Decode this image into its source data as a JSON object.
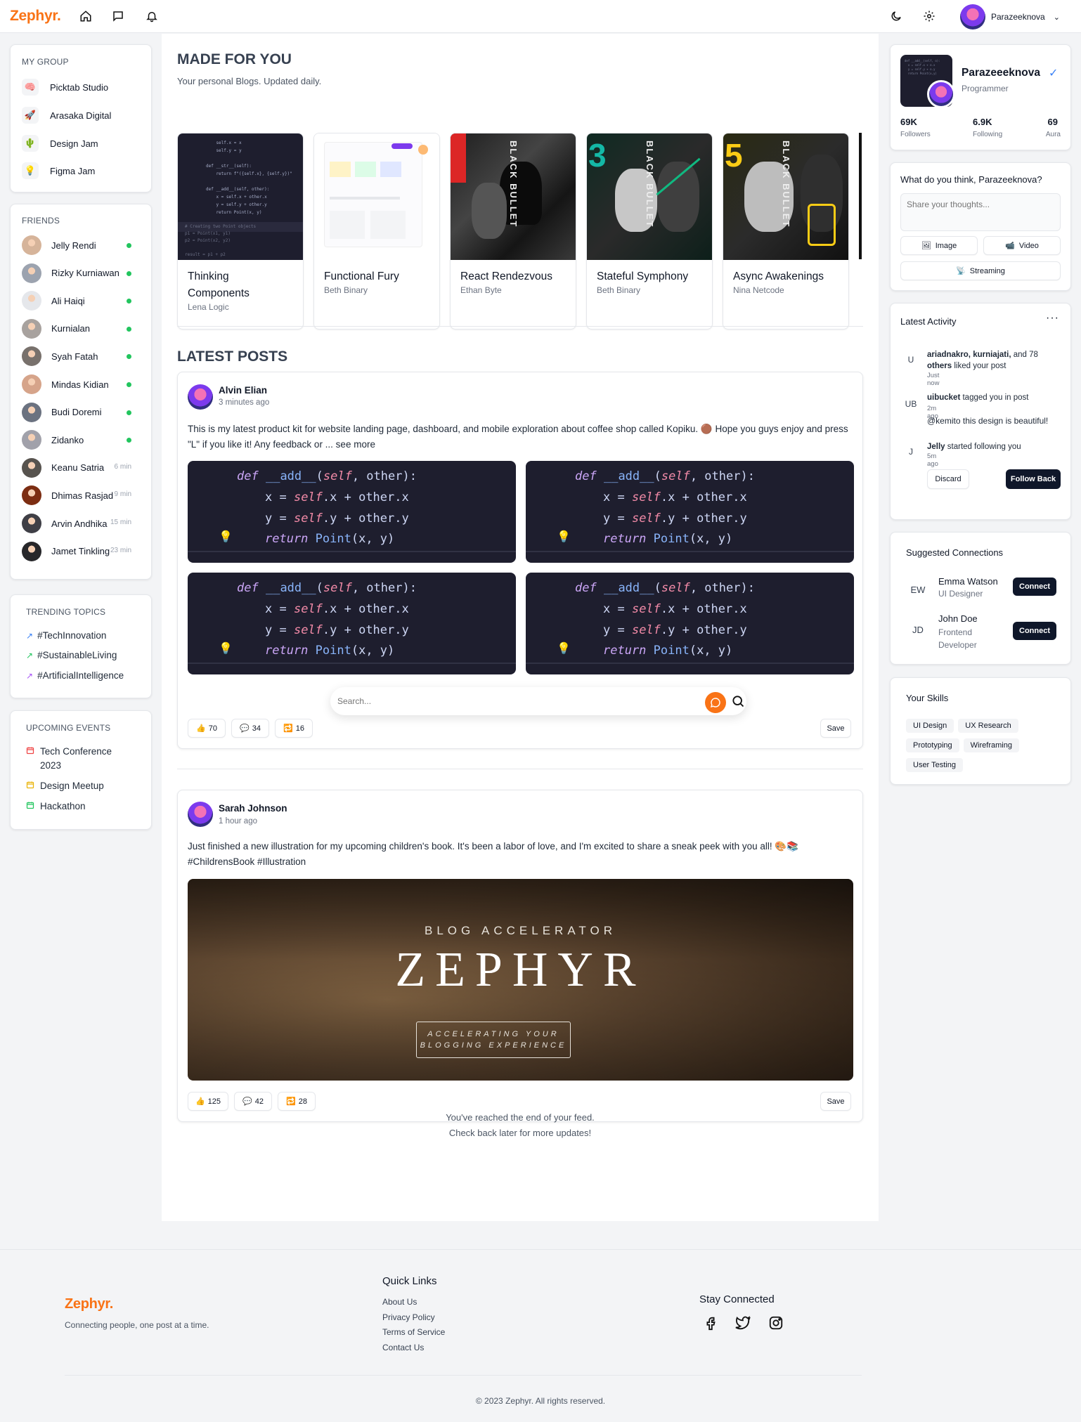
{
  "header": {
    "logo": "Zephyr.",
    "user_name": "Parazeeknova"
  },
  "my_group": {
    "title": "MY GROUP",
    "items": [
      {
        "label": "Picktab Studio",
        "icon": "brain-icon"
      },
      {
        "label": "Arasaka Digital",
        "icon": "rocket-icon"
      },
      {
        "label": "Design Jam",
        "icon": "cactus-icon"
      },
      {
        "label": "Figma Jam",
        "icon": "lightbulb-icon"
      }
    ]
  },
  "friends": {
    "title": "FRIENDS",
    "items": [
      {
        "name": "Jelly Rendi",
        "status": "online"
      },
      {
        "name": "Rizky Kurniawan",
        "status": "online"
      },
      {
        "name": "Ali Haiqi",
        "status": "online"
      },
      {
        "name": "Kurnialan",
        "status": "online"
      },
      {
        "name": "Syah Fatah",
        "status": "online"
      },
      {
        "name": "Mindas Kidian",
        "status": "online"
      },
      {
        "name": "Budi Doremi",
        "status": "online"
      },
      {
        "name": "Zidanko",
        "status": "online"
      },
      {
        "name": "Keanu Satria",
        "status": "6 min"
      },
      {
        "name": "Dhimas Rasjad",
        "status": "9 min"
      },
      {
        "name": "Arvin Andhika",
        "status": "15 min"
      },
      {
        "name": "Jamet Tinkling",
        "status": "23 min"
      }
    ]
  },
  "trending": {
    "title": "TRENDING TOPICS",
    "items": [
      {
        "label": "#TechInnovation",
        "color": "#3b82f6"
      },
      {
        "label": "#SustainableLiving",
        "color": "#22c55e"
      },
      {
        "label": "#ArtificialIntelligence",
        "color": "#a855f7"
      }
    ]
  },
  "events": {
    "title": "UPCOMING EVENTS",
    "items": [
      {
        "label": "Tech Conference 2023",
        "color": "#ef4444"
      },
      {
        "label": "Design Meetup",
        "color": "#eab308"
      },
      {
        "label": "Hackathon",
        "color": "#22c55e"
      }
    ]
  },
  "made_for_you": {
    "title": "MADE FOR YOU",
    "subtitle": "Your personal Blogs. Updated daily.",
    "blogs": [
      {
        "title": "Thinking Components",
        "author": "Lena Logic"
      },
      {
        "title": "Functional Fury",
        "author": "Beth Binary"
      },
      {
        "title": "React Rendezvous",
        "author": "Ethan Byte"
      },
      {
        "title": "Stateful Symphony",
        "author": "Beth Binary"
      },
      {
        "title": "Async Awakenings",
        "author": "Nina Netcode"
      }
    ]
  },
  "latest_posts": {
    "title": "LATEST POSTS",
    "code_lines": [
      "def __add__(self, other):",
      "x = self.x + other.x",
      "y = self.y + other.y",
      "return Point(x, y)"
    ],
    "posts": [
      {
        "author": "Alvin Elian",
        "time": "3 minutes ago",
        "text": "This is my latest product kit for website landing page, dashboard, and mobile exploration about coffee shop called Kopiku. 🟤  Hope you guys enjoy and press \"L\" if you like it! Any feedback or ... see more",
        "likes": "70",
        "comments": "34",
        "shares": "16",
        "save": "Save"
      },
      {
        "author": "Sarah Johnson",
        "time": "1 hour ago",
        "text": "Just finished a new illustration for my upcoming children's book. It's been a labor of love, and I'm excited to share a sneak peek with you all! 🎨📚 #ChildrensBook #Illustration",
        "likes": "125",
        "comments": "42",
        "shares": "28",
        "save": "Save",
        "banner": {
          "kicker": "BLOG ACCELERATOR",
          "title": "ZEPHYR",
          "line1": "ACCELERATING YOUR",
          "line2": "BLOGGING EXPERIENCE"
        }
      }
    ]
  },
  "search": {
    "placeholder": "Search..."
  },
  "feed_end": {
    "line1": "You've reached the end of your feed.",
    "line2": "Check back later for more updates!"
  },
  "profile": {
    "name": "Parazeeeknova",
    "role": "Programmer",
    "stats": [
      {
        "value": "69K",
        "label": "Followers"
      },
      {
        "value": "6.9K",
        "label": "Following"
      },
      {
        "value": "69",
        "label": "Aura"
      }
    ]
  },
  "composer": {
    "title": "What do you think, Parazeeknova?",
    "placeholder": "Share your thoughts...",
    "image": "Image",
    "video": "Video",
    "streaming": "Streaming"
  },
  "activity": {
    "title": "Latest Activity",
    "items": [
      {
        "avatar": "U",
        "bold": "ariadnakro, kurniajati,",
        "rest": " and 78 ",
        "bold2": "others",
        "rest2": " liked your post",
        "time": "Just now"
      },
      {
        "avatar": "UB",
        "bold": "uibucket",
        "rest": " tagged you in post",
        "time": "2m ago",
        "quote": "@kemito this design is beautiful!"
      },
      {
        "avatar": "J",
        "bold": "Jelly",
        "rest": " started following you",
        "time": "5m ago"
      }
    ],
    "discard": "Discard",
    "follow_back": "Follow Back"
  },
  "suggested": {
    "title": "Suggested Connections",
    "items": [
      {
        "initials": "EW",
        "name": "Emma Watson",
        "role": "UI Designer"
      },
      {
        "initials": "JD",
        "name": "John Doe",
        "role": "Frontend Developer"
      }
    ],
    "connect": "Connect"
  },
  "skills": {
    "title": "Your Skills",
    "items": [
      "UI Design",
      "UX Research",
      "Prototyping",
      "Wireframing",
      "User Testing"
    ]
  },
  "footer": {
    "logo": "Zephyr.",
    "tagline": "Connecting people, one post at a time.",
    "quick_links_title": "Quick Links",
    "links": [
      "About Us",
      "Privacy Policy",
      "Terms of Service",
      "Contact Us"
    ],
    "stay_title": "Stay Connected",
    "copyright": "© 2023 Zephyr. All rights reserved."
  },
  "colors": {
    "accent": "#f97316",
    "dark": "#0f172a",
    "online": "#22c55e"
  }
}
